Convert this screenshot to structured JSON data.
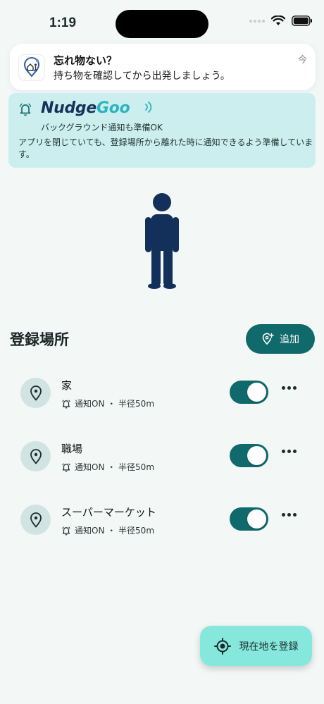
{
  "status_bar": {
    "time": "1:19"
  },
  "notification": {
    "title": "忘れ物ない？",
    "body": "持ち物を確認してから出発しましょう。",
    "time": "今"
  },
  "banner": {
    "brand_main": "Nudge",
    "brand_accent": "Goo",
    "subtitle": "バックグラウンド通知も準備OK",
    "description": "アプリを閉じていても、登録場所から離れた時に通知できるよう準備しています。"
  },
  "places_section": {
    "title": "登録場所",
    "add_label": "追加"
  },
  "places": [
    {
      "name": "家",
      "meta": "通知ON ・ 半径50m",
      "enabled": true
    },
    {
      "name": "職場",
      "meta": "通知ON ・ 半径50m",
      "enabled": true
    },
    {
      "name": "スーパーマーケット",
      "meta": "通知ON ・ 半径50m",
      "enabled": true
    }
  ],
  "fab": {
    "label": "現在地を登録"
  },
  "colors": {
    "accent": "#10696a",
    "banner_bg": "#cdeeee",
    "fab_bg": "#86e8dc",
    "figure": "#12305a"
  }
}
